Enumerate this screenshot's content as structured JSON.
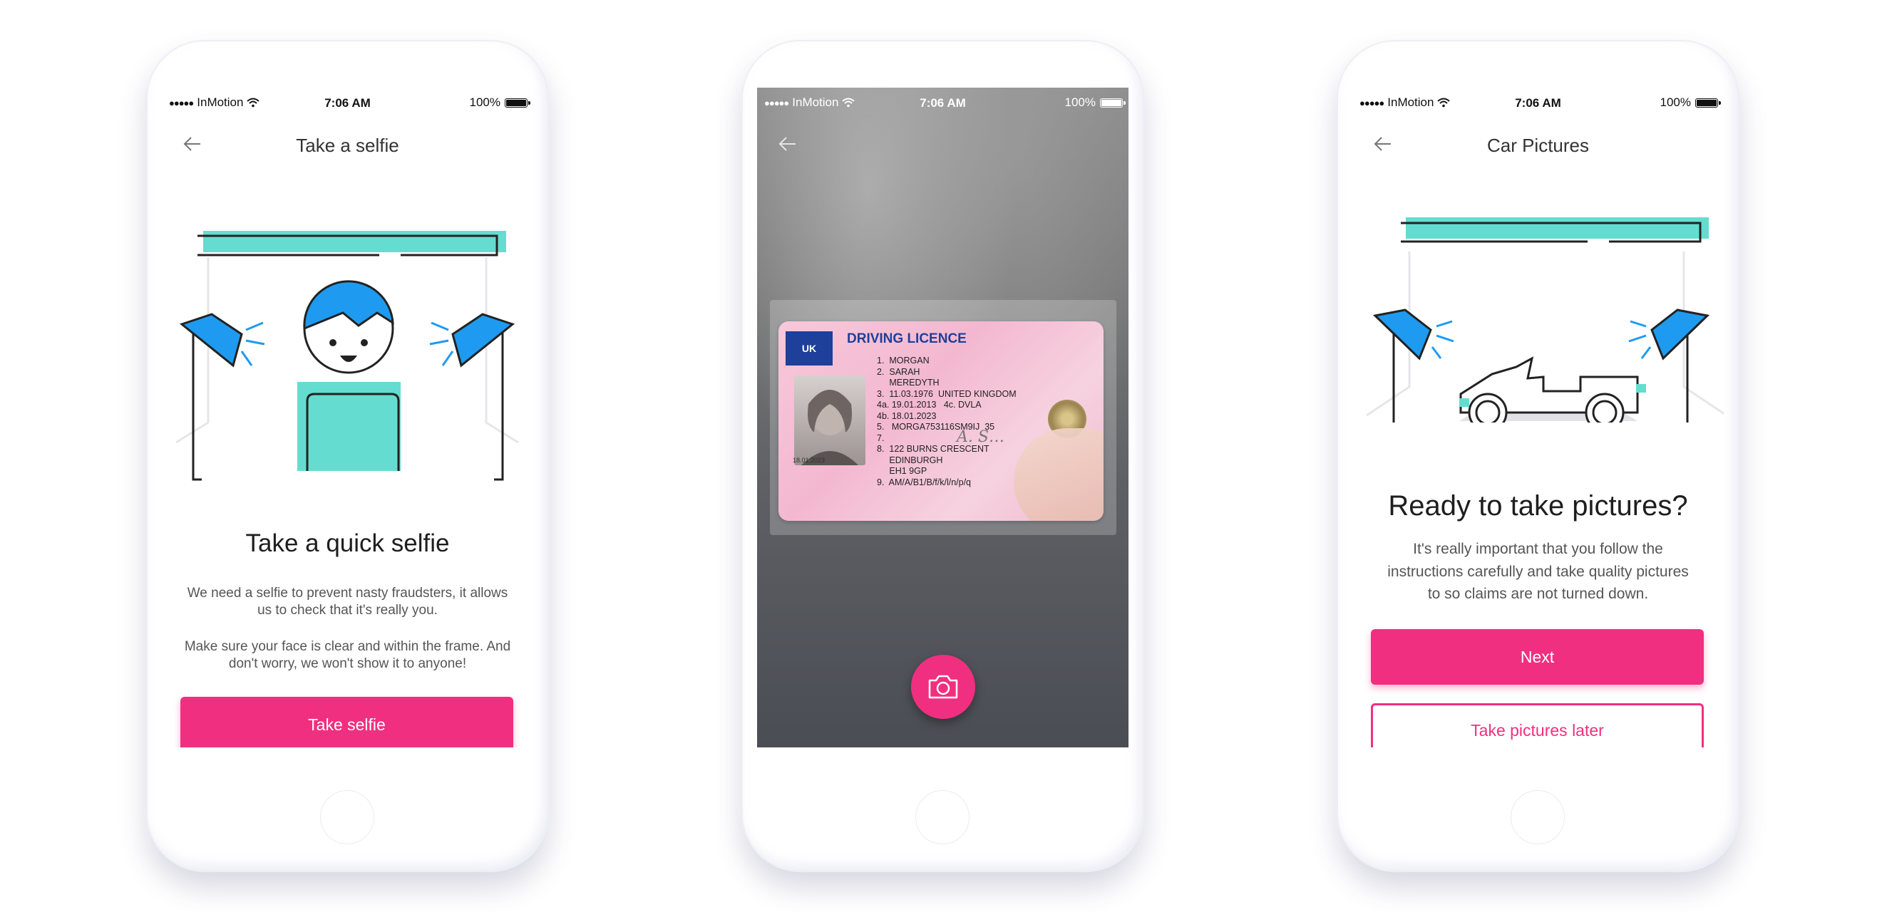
{
  "colors": {
    "accent": "#f12f80",
    "teal": "#64ddd0",
    "blue": "#1e9bf0"
  },
  "status_bar": {
    "carrier": "InMotion",
    "time": "7:06 AM",
    "battery": "100%"
  },
  "screens": [
    {
      "nav_title": "Take a selfie",
      "headline": "Take a quick selfie",
      "paragraph_1": "We need a selfie to prevent nasty fraudsters, it allows us to check that it's really you.",
      "paragraph_2": "Make sure your face is clear and within the frame. And don't worry, we won't show it to anyone!",
      "primary_button": "Take selfie",
      "progress": 0.13
    },
    {
      "nav_title": "",
      "licence": {
        "country": "UK",
        "title": "DRIVING LICENCE",
        "fields": [
          "1.  MORGAN",
          "2.  SARAH",
          "     MEREDYTH",
          "3.  11.03.1976  UNITED KINGDOM",
          "4a. 19.01.2013   4c. DVLA",
          "4b. 18.01.2023",
          "5.   MORGA753116SM9IJ  35",
          "7.",
          "8.  122 BURNS CRESCENT",
          "     EDINBURGH",
          "     EH1 9GP",
          "9.  AM/A/B1/B/f/k/l/n/p/q"
        ],
        "photo_date": "18.01.2023"
      },
      "shutter_icon": "camera-icon"
    },
    {
      "nav_title": "Car Pictures",
      "headline": "Ready to take pictures?",
      "paragraph_1": "It's really important that you follow  the instructions carefully and take quality pictures to so claims are not turned down.",
      "primary_button": "Next",
      "secondary_button": "Take pictures later",
      "progress": 0.59
    }
  ]
}
